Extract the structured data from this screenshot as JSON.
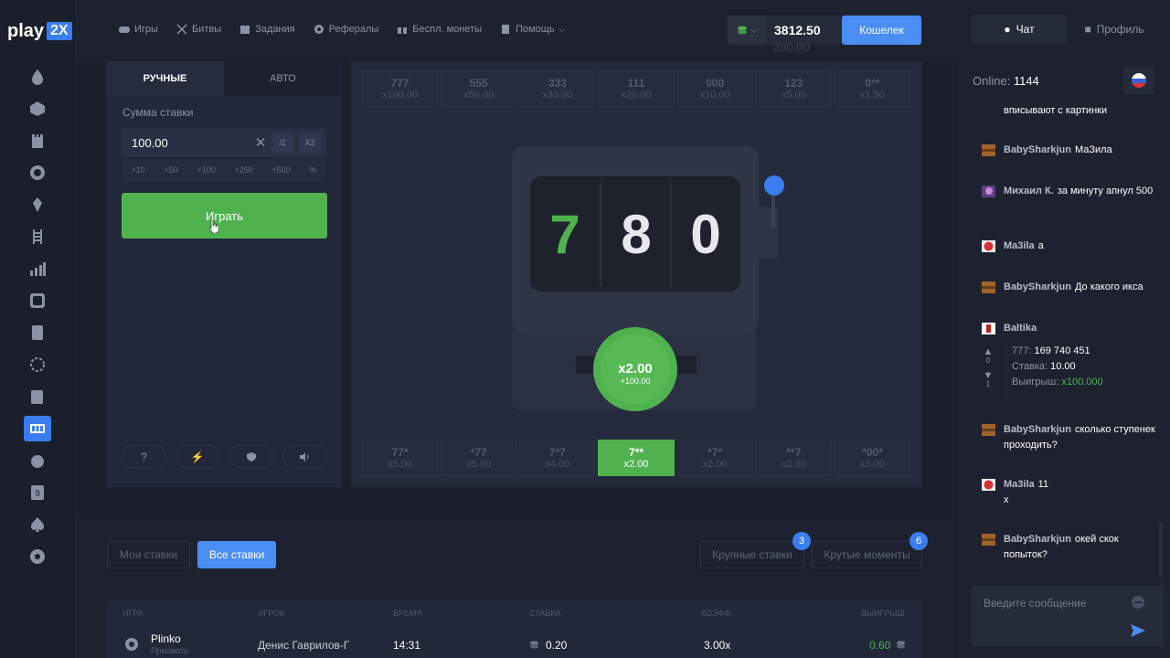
{
  "logo": {
    "text": "play",
    "badge": "2X"
  },
  "nav": {
    "items": [
      {
        "label": "Игры",
        "icon": "gamepad-icon"
      },
      {
        "label": "Битвы",
        "icon": "swords-icon"
      },
      {
        "label": "Задания",
        "icon": "calendar-icon"
      },
      {
        "label": "Рефералы",
        "icon": "gear-icon"
      },
      {
        "label": "Беспл. монеты",
        "icon": "gift-icon"
      },
      {
        "label": "Помощь",
        "icon": "book-icon"
      }
    ],
    "balance": "3812.50",
    "balance_ghost": "200.00",
    "wallet": "Кошелек"
  },
  "bet_panel": {
    "tab_manual": "РУЧНЫЕ",
    "tab_auto": "АВТО",
    "amount_label": "Сумма ставки",
    "amount": "100.00",
    "half": "/2",
    "double": "X2",
    "quick": [
      "+10",
      "+50",
      "+100",
      "+250",
      "+500",
      "%"
    ],
    "play": "Играть"
  },
  "slot": {
    "top_payouts": [
      {
        "combo": "777",
        "mult": "x100.00"
      },
      {
        "combo": "555",
        "mult": "x50.00"
      },
      {
        "combo": "333",
        "mult": "x30.00"
      },
      {
        "combo": "111",
        "mult": "x20.00"
      },
      {
        "combo": "000",
        "mult": "x10.00"
      },
      {
        "combo": "123",
        "mult": "x5.00"
      },
      {
        "combo": "0**",
        "mult": "x1.50"
      }
    ],
    "bottom_payouts": [
      {
        "combo": "77*",
        "mult": "x5.00"
      },
      {
        "combo": "*77",
        "mult": "x5.00"
      },
      {
        "combo": "7*7",
        "mult": "x4.00"
      },
      {
        "combo": "7**",
        "mult": "x2.00"
      },
      {
        "combo": "*7*",
        "mult": "x2.00"
      },
      {
        "combo": "**7",
        "mult": "x2.00"
      },
      {
        "combo": "*00*",
        "mult": "x3.00"
      }
    ],
    "reels": [
      "7",
      "8",
      "0"
    ],
    "win_mult": "x2.00",
    "win_amount": "+100.00"
  },
  "bets": {
    "my_bets": "Мои ставки",
    "all_bets": "Все ставки",
    "big_bets": "Крупные ставки",
    "big_bets_count": "3",
    "cool_moments": "Крутые моменты",
    "cool_moments_count": "6",
    "headers": [
      "Игра",
      "Игрок",
      "Время",
      "Ставка",
      "Коэфф.",
      "Выигрыш"
    ],
    "row": {
      "game": "Plinko",
      "sub": "Просмотр",
      "player": "Денис Гаврилов-Г",
      "time": "14:31",
      "bet": "0.20",
      "coef": "3.00x",
      "win": "0.60"
    }
  },
  "chat": {
    "tab_chat": "Чат",
    "tab_profile": "Профиль",
    "online_label": "Online:",
    "online_count": "1144",
    "messages": [
      {
        "user": "",
        "text": "вписывают с картинки"
      },
      {
        "user": "BabySharkjun",
        "text": "МаЗила"
      },
      {
        "user": "Михаил К.",
        "text": "за минуту апнул 500"
      },
      {
        "user": "Ma3ila",
        "text": "а"
      },
      {
        "user": "BabySharkjun",
        "text": "До какого икса"
      },
      {
        "user": "Baltika",
        "text": ""
      },
      {
        "user": "BabySharkjun",
        "text": "сколько ступенек проходить?"
      },
      {
        "user": "Ma3ila",
        "text": "11 x"
      },
      {
        "user": "BabySharkjun",
        "text": "окей скок попыток?"
      }
    ],
    "share": {
      "combo_label": "777:",
      "combo_value": "169 740 451",
      "bet_label": "Ставка:",
      "bet_value": "10.00",
      "win_label": "Выигрыш:",
      "win_value": "x100.000"
    },
    "votes_up": "0",
    "votes_down": "1",
    "input_placeholder": "Введите сообщение"
  }
}
